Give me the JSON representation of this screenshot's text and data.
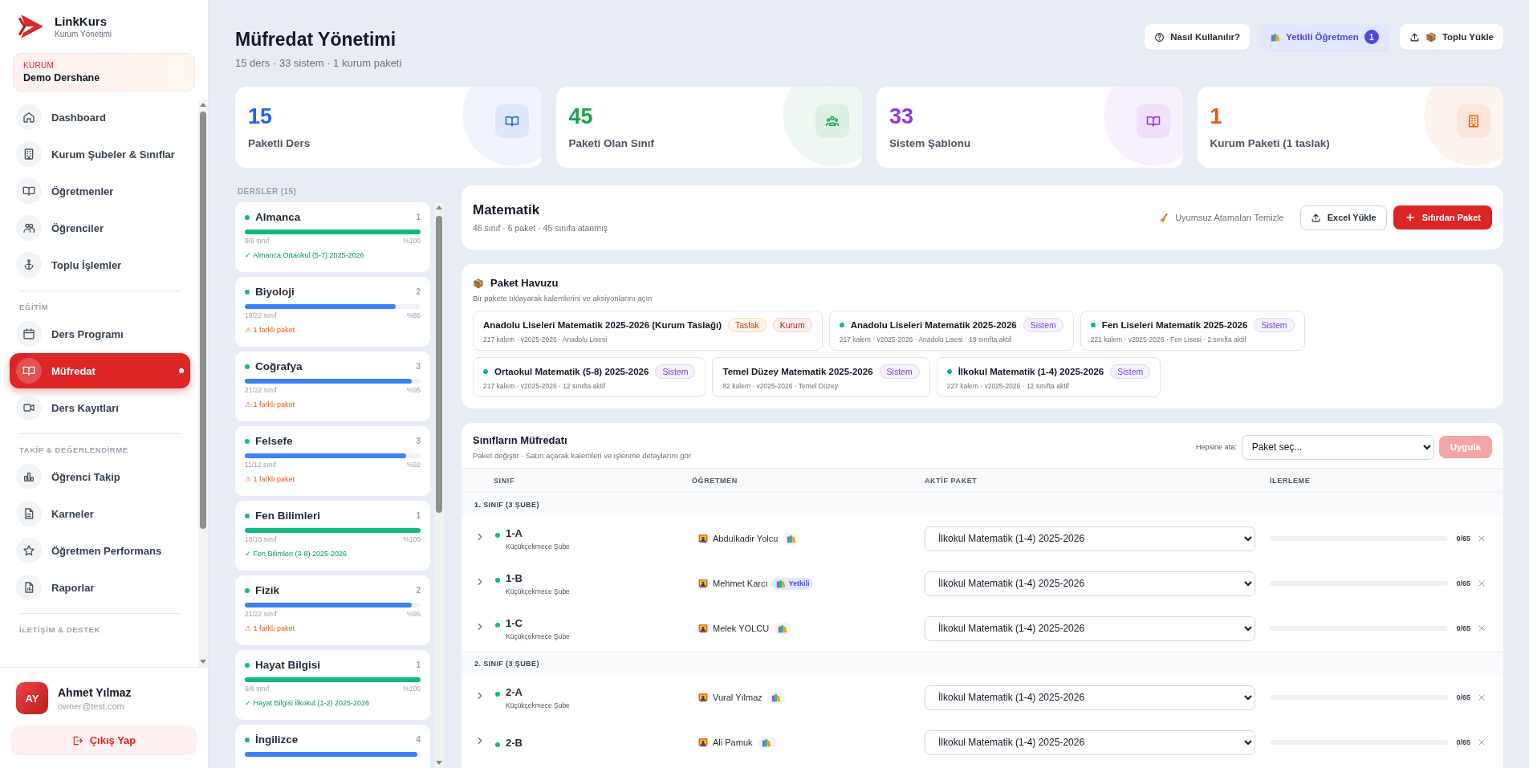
{
  "brand": {
    "name": "LinkKurs",
    "subtitle": "Kurum Yönetimi"
  },
  "institution": {
    "label": "KURUM",
    "name": "Demo Dershane"
  },
  "sidebar": {
    "sections": [
      {
        "items": [
          {
            "label": "Dashboard",
            "kind": "home",
            "selected": false
          },
          {
            "label": "Kurum Şubeler & Sınıflar",
            "kind": "building",
            "selected": false
          },
          {
            "label": "Öğretmenler",
            "kind": "book",
            "selected": false
          },
          {
            "label": "Öğrenciler",
            "kind": "users",
            "selected": false
          },
          {
            "label": "Toplu İşlemler",
            "kind": "anchor",
            "selected": false
          }
        ]
      },
      {
        "title": "EĞİTİM",
        "items": [
          {
            "label": "Ders Programı",
            "kind": "calendar",
            "selected": false
          },
          {
            "label": "Müfredat",
            "kind": "book",
            "selected": true
          },
          {
            "label": "Ders Kayıtları",
            "kind": "video",
            "selected": false
          }
        ]
      },
      {
        "title": "TAKİP & DEĞERLENDİRME",
        "items": [
          {
            "label": "Öğrenci Takip",
            "kind": "chart",
            "selected": false
          },
          {
            "label": "Karneler",
            "kind": "file",
            "selected": false
          },
          {
            "label": "Öğretmen Performans",
            "kind": "star",
            "selected": false
          },
          {
            "label": "Raporlar",
            "kind": "report",
            "selected": false
          }
        ]
      },
      {
        "title": "İLETİŞİM & DESTEK"
      }
    ]
  },
  "user": {
    "initials": "AY",
    "name": "Ahmet Yılmaz",
    "email": "owner@test.com"
  },
  "logout": "Çıkış Yap",
  "page": {
    "title": "Müfredat Yönetimi",
    "subtitle": "15 ders · 33 sistem · 1 kurum paketi"
  },
  "header_buttons": [
    {
      "label": "Nasıl Kullanılır?",
      "kind": "help"
    },
    {
      "label": "Yetkili Öğretmen",
      "kind": "authorized",
      "count": "1"
    },
    {
      "label": "Toplu Yükle",
      "kind": "upload"
    }
  ],
  "stats": [
    {
      "value": "15",
      "label": "Paketli Ders",
      "color": "#2563eb",
      "kind": "book"
    },
    {
      "value": "45",
      "label": "Paketi Olan Sınıf",
      "color": "#16a34a",
      "kind": "group"
    },
    {
      "value": "33",
      "label": "Sistem Şablonu",
      "color": "#9333ea",
      "kind": "book"
    },
    {
      "value": "1",
      "label": "Kurum Paketi (1 taslak)",
      "color": "#ea580c",
      "kind": "building"
    }
  ],
  "courses": {
    "title": "DERSLER (15)",
    "items": [
      {
        "name": "Almanca",
        "count": "1",
        "level": 1,
        "done": "9/9 sınıf",
        "percent": "%100",
        "kind": "ok",
        "note": "✓ Almanca Ortaokul (5-7) 2025-2026"
      },
      {
        "name": "Biyoloji",
        "count": "2",
        "level": 0.86,
        "done": "19/22 sınıf",
        "percent": "%86",
        "kind": "warn",
        "note": "⚠ 1 farklı paket"
      },
      {
        "name": "Coğrafya",
        "count": "3",
        "level": 0.95,
        "done": "21/22 sınıf",
        "percent": "%95",
        "kind": "warn",
        "note": "⚠ 1 farklı paket"
      },
      {
        "name": "Felsefe",
        "count": "3",
        "level": 0.92,
        "done": "11/12 sınıf",
        "percent": "%92",
        "kind": "warn",
        "note": "⚠ 1 farklı paket"
      },
      {
        "name": "Fen Bilimleri",
        "count": "1",
        "level": 1,
        "done": "18/18 sınıf",
        "percent": "%100",
        "kind": "ok",
        "note": "✓ Fen Bilimleri (3-8) 2025-2026"
      },
      {
        "name": "Fizik",
        "count": "2",
        "level": 0.95,
        "done": "21/22 sınıf",
        "percent": "%95",
        "kind": "warn",
        "note": "⚠ 1 farklı paket"
      },
      {
        "name": "Hayat Bilgisi",
        "count": "1",
        "level": 1,
        "done": "6/6 sınıf",
        "percent": "%100",
        "kind": "ok",
        "note": "✓ Hayat Bilgisi İlkokul (1-2) 2025-2026"
      },
      {
        "name": "İngilizce",
        "count": "4",
        "level": 0.98,
        "kind": "warn"
      }
    ]
  },
  "subject": {
    "title": "Matematik",
    "subtitle": "46 sınıf · 6 paket · 45 sınıfa atanmış",
    "actions": [
      {
        "label": "Uyumsuz Atamaları Temizle",
        "kind": "link"
      },
      {
        "label": "Excel Yükle",
        "kind": "outline"
      },
      {
        "label": "Sıfırdan Paket",
        "kind": "primary"
      }
    ]
  },
  "pool": {
    "title": "Paket Havuzu",
    "subtitle": "Bir pakete tıklayarak kalemlerini ve aksiyonlarını açın",
    "packages": [
      {
        "name": "Anadolu Liseleri Matematik 2025-2026 (Kurum Taslağı)",
        "active": false,
        "meta": "217 kalem · v2025-2026 · Anadolu Lisesi",
        "tags": [
          {
            "label": "Taslak",
            "kind": "draft"
          },
          {
            "label": "Kurum",
            "kind": "institution"
          }
        ]
      },
      {
        "name": "Anadolu Liseleri Matematik 2025-2026",
        "active": true,
        "meta": "217 kalem · v2025-2026 · Anadolu Lisesi · 19 sınıfta aktif",
        "tags": [
          {
            "label": "Sistem",
            "kind": "system"
          }
        ]
      },
      {
        "name": "Fen Liseleri Matematik 2025-2026",
        "active": true,
        "meta": "221 kalem · v2025-2026 · Fen Lisesi · 2 sınıfta aktif",
        "tags": [
          {
            "label": "Sistem",
            "kind": "system"
          }
        ]
      },
      {
        "name": "Ortaokul Matematik (5-8) 2025-2026",
        "active": true,
        "meta": "217 kalem · v2025-2026 · 12 sınıfta aktif",
        "tags": [
          {
            "label": "Sistem",
            "kind": "system"
          }
        ]
      },
      {
        "name": "Temel Düzey Matematik 2025-2026",
        "active": false,
        "meta": "82 kalem · v2025-2026 · Temel Düzey",
        "tags": [
          {
            "label": "Sistem",
            "kind": "system"
          }
        ]
      },
      {
        "name": "İlkokul Matematik (1-4) 2025-2026",
        "active": true,
        "meta": "227 kalem · v2025-2026 · 12 sınıfta aktif",
        "tags": [
          {
            "label": "Sistem",
            "kind": "system"
          }
        ]
      }
    ]
  },
  "class_table": {
    "title": "Sınıfların Müfredatı",
    "subtitle": "Paket değiştir · Satırı açarak kalemleri ve işlenme detaylarını gör",
    "assign_label": "Hepsine ata:",
    "assign_select": "Paket seç...",
    "apply": {
      "label": "Uygula",
      "disabled": true
    },
    "columns": [
      "SINIF",
      "ÖĞRETMEN",
      "AKTİF PAKET",
      "İLERLEME"
    ],
    "groups": [
      {
        "title": "1. SINIF (3 ŞUBE)",
        "rows": [
          {
            "name": "1-A",
            "active": true,
            "branch": "Küçükçekmece Şube",
            "teacher": "Abdulkadir Yolcu",
            "badge": {
              "kind": "books"
            },
            "package": "İlkokul Matematik (1-4) 2025-2026",
            "level": 0,
            "progress": "0/65"
          },
          {
            "name": "1-B",
            "active": true,
            "branch": "Küçükçekmece Şube",
            "teacher": "Mehmet Karcı",
            "badge": {
              "kind": "authorized",
              "label": "Yetkili"
            },
            "package": "İlkokul Matematik (1-4) 2025-2026",
            "level": 0,
            "progress": "0/65"
          },
          {
            "name": "1-C",
            "active": true,
            "branch": "Küçükçekmece Şube",
            "teacher": "Melek YOLCU",
            "badge": {
              "kind": "books"
            },
            "package": "İlkokul Matematik (1-4) 2025-2026",
            "level": 0,
            "progress": "0/65"
          }
        ]
      },
      {
        "title": "2. SINIF (3 ŞUBE)",
        "rows": [
          {
            "name": "2-A",
            "active": true,
            "branch": "Küçükçekmece Şube",
            "teacher": "Vural Yılmaz",
            "badge": {
              "kind": "books"
            },
            "package": "İlkokul Matematik (1-4) 2025-2026",
            "level": 0,
            "progress": "0/65"
          },
          {
            "name": "2-B",
            "active": true,
            "teacher": "Ali Pamuk",
            "badge": {
              "kind": "books"
            },
            "package": "İlkokul Matematik (1-4) 2025-2026",
            "level": 0,
            "progress": "0/65"
          }
        ]
      }
    ]
  }
}
